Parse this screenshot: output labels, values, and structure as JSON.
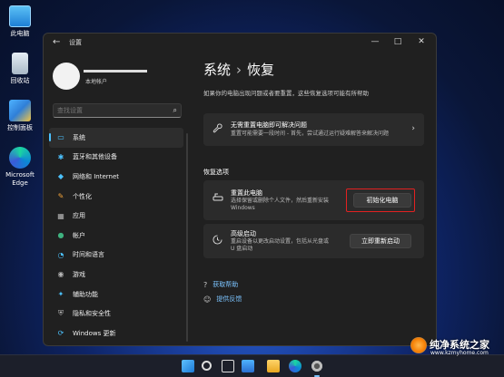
{
  "desktop": {
    "icons": [
      {
        "label": "此电脑",
        "icon": "computer-icon"
      },
      {
        "label": "回收站",
        "icon": "recycle-bin-icon"
      },
      {
        "label": "控制面板",
        "icon": "control-panel-icon"
      },
      {
        "label": "Microsoft Edge",
        "icon": "edge-icon"
      }
    ]
  },
  "window": {
    "title": "设置",
    "back_icon": "←",
    "controls": {
      "minimize": "—",
      "maximize": "□",
      "close": "✕"
    }
  },
  "profile": {
    "account": "本地帐户"
  },
  "search": {
    "placeholder": "查找设置",
    "icon": "⌕"
  },
  "nav": {
    "items": [
      {
        "label": "系统",
        "icon": "▭",
        "color": "#4cc2ff",
        "active": true
      },
      {
        "label": "蓝牙和其他设备",
        "icon": "✱",
        "color": "#4cc2ff"
      },
      {
        "label": "网络和 Internet",
        "icon": "◆",
        "color": "#4cc2ff"
      },
      {
        "label": "个性化",
        "icon": "✎",
        "color": "#f2a33a"
      },
      {
        "label": "应用",
        "icon": "▦",
        "color": "#b8b8b8"
      },
      {
        "label": "帐户",
        "icon": "●",
        "color": "#3fb27f"
      },
      {
        "label": "时间和语言",
        "icon": "◔",
        "color": "#4cc2ff"
      },
      {
        "label": "游戏",
        "icon": "◉",
        "color": "#b8b8b8"
      },
      {
        "label": "辅助功能",
        "icon": "✦",
        "color": "#4cc2ff"
      },
      {
        "label": "隐私和安全性",
        "icon": "⛨",
        "color": "#b8b8b8"
      },
      {
        "label": "Windows 更新",
        "icon": "⟳",
        "color": "#4cc2ff"
      }
    ]
  },
  "content": {
    "breadcrumb": {
      "parent": "系统",
      "separator": "›",
      "current": "恢复"
    },
    "subtitle": "如果你的电脑出现问题或者要重置，这些恢复选项可能有所帮助",
    "fix_card": {
      "title": "无需重置电脑即可解决问题",
      "desc": "重置可能需要一段时间 - 首先，尝试通过运行疑难解答来解决问题",
      "icon": "wrench-icon",
      "chevron": "›"
    },
    "section_title": "恢复选项",
    "reset_card": {
      "title": "重置此电脑",
      "desc_line1": "选择保留或删除个人文件，然后重新安装",
      "desc_line2": "Windows",
      "button": "初始化电脑",
      "highlight_color": "#e32121"
    },
    "advanced_card": {
      "title": "高级启动",
      "desc_line1": "重启设备以更改启动设置，包括从光盘或",
      "desc_line2": "U 盘启动",
      "button": "立即重新启动"
    },
    "links": [
      {
        "label": "获取帮助",
        "icon": "help-icon"
      },
      {
        "label": "提供反馈",
        "icon": "feedback-icon"
      }
    ]
  },
  "watermark": {
    "name": "纯净系统之家",
    "url": "www.kzmyhome.com"
  },
  "colors": {
    "accent": "#4cc2ff",
    "highlight": "#e32121",
    "window_bg": "#202020",
    "card_bg": "#2b2b2b"
  }
}
